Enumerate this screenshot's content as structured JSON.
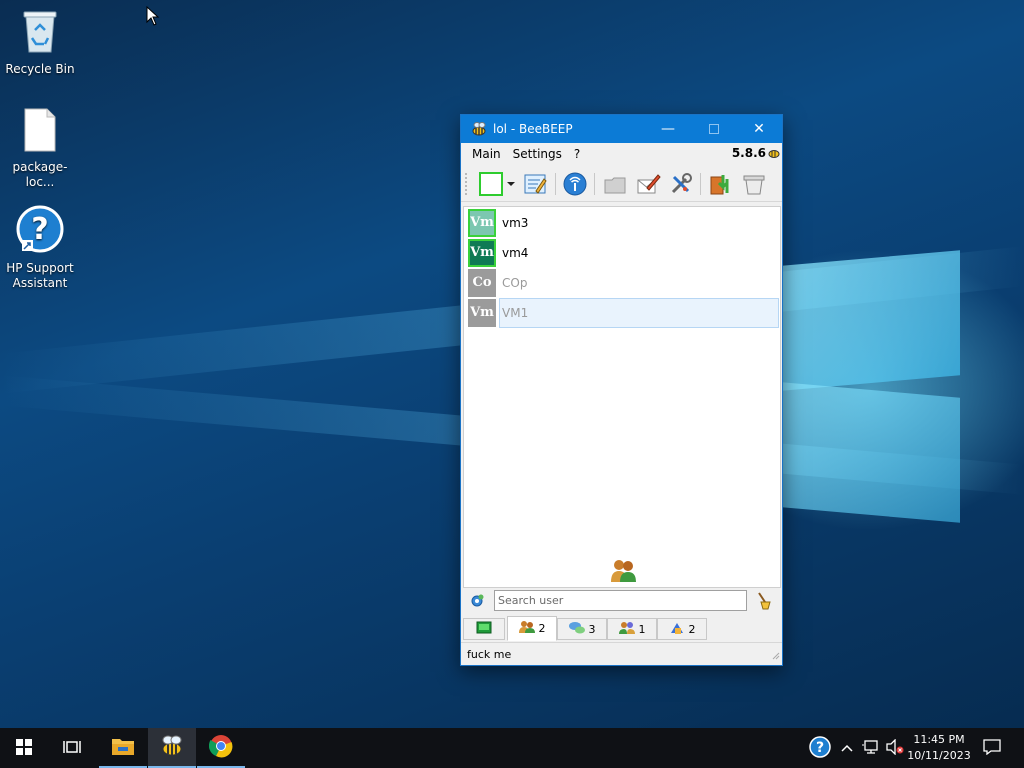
{
  "desktop": {
    "icons": [
      {
        "label": "Recycle Bin",
        "icon": "recycle-bin-icon"
      },
      {
        "label": "package-loc...",
        "icon": "file-icon"
      },
      {
        "label": "HP Support Assistant",
        "icon": "hp-support-icon"
      }
    ]
  },
  "window": {
    "title": "lol - BeeBEEP",
    "version": "5.8.6",
    "menu": [
      "Main",
      "Settings",
      "?"
    ],
    "toolbar": [
      {
        "icon": "status-select-icon"
      },
      {
        "icon": "status-dropdown-icon"
      },
      {
        "icon": "edit-profile-icon"
      },
      {
        "icon": "network-icon"
      },
      {
        "icon": "folder-icon"
      },
      {
        "icon": "write-message-icon"
      },
      {
        "icon": "tools-icon"
      },
      {
        "icon": "update-icon"
      },
      {
        "icon": "trash-icon"
      }
    ],
    "users": [
      {
        "initials": "Vm",
        "name": "vm3",
        "color": "#7cc7b0",
        "online": true,
        "border": "#3ad13a"
      },
      {
        "initials": "Vm",
        "name": "vm4",
        "color": "#0f7a54",
        "online": true,
        "border": "#3ad13a"
      },
      {
        "initials": "Co",
        "name": "COp",
        "color": "#9b9b9b",
        "online": false,
        "border": ""
      },
      {
        "initials": "Vm",
        "name": "VM1",
        "color": "#9b9b9b",
        "online": false,
        "border": ""
      }
    ],
    "search": {
      "placeholder": "Search user"
    },
    "tabs": [
      {
        "icon": "home-icon",
        "count": ""
      },
      {
        "icon": "users-icon",
        "count": "2"
      },
      {
        "icon": "chats-icon",
        "count": "3"
      },
      {
        "icon": "groups-icon",
        "count": "1"
      },
      {
        "icon": "shares-icon",
        "count": "2"
      }
    ],
    "status_text": "fuck me"
  },
  "taskbar": {
    "clock_time": "11:45 PM",
    "clock_date": "10/11/2023"
  }
}
